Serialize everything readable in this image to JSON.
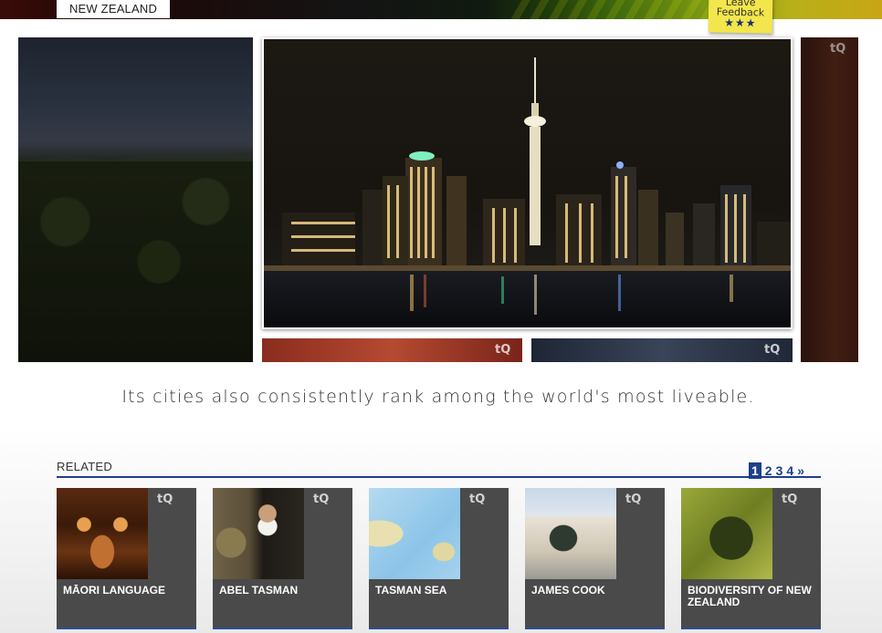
{
  "header": {
    "region_tab": "NEW ZEALAND",
    "feedback_line1": "Leave",
    "feedback_line2": "Feedback",
    "feedback_stars": "★★★"
  },
  "carousel": {
    "caption": "Its cities also consistently rank among the world's most liveable.",
    "badge": "tQ"
  },
  "related": {
    "label": "RELATED",
    "pages": [
      "1",
      "2",
      "3",
      "4"
    ],
    "current_page": "1",
    "next": "»",
    "items": [
      {
        "title": "MĀORI LANGUAGE",
        "badge": "tQ"
      },
      {
        "title": "ABEL TASMAN",
        "badge": "tQ"
      },
      {
        "title": "TASMAN SEA",
        "badge": "tQ"
      },
      {
        "title": "JAMES COOK",
        "badge": "tQ"
      },
      {
        "title": "BIODIVERSITY OF NEW ZEALAND",
        "badge": "tQ"
      }
    ]
  },
  "colors": {
    "accent": "#1e3f8a",
    "card_bg": "#4a4a4a",
    "feedback_note": "#f3e64c"
  },
  "icons": {
    "badge_icon": "tq-logo-icon",
    "stars_icon": "star-icon"
  }
}
